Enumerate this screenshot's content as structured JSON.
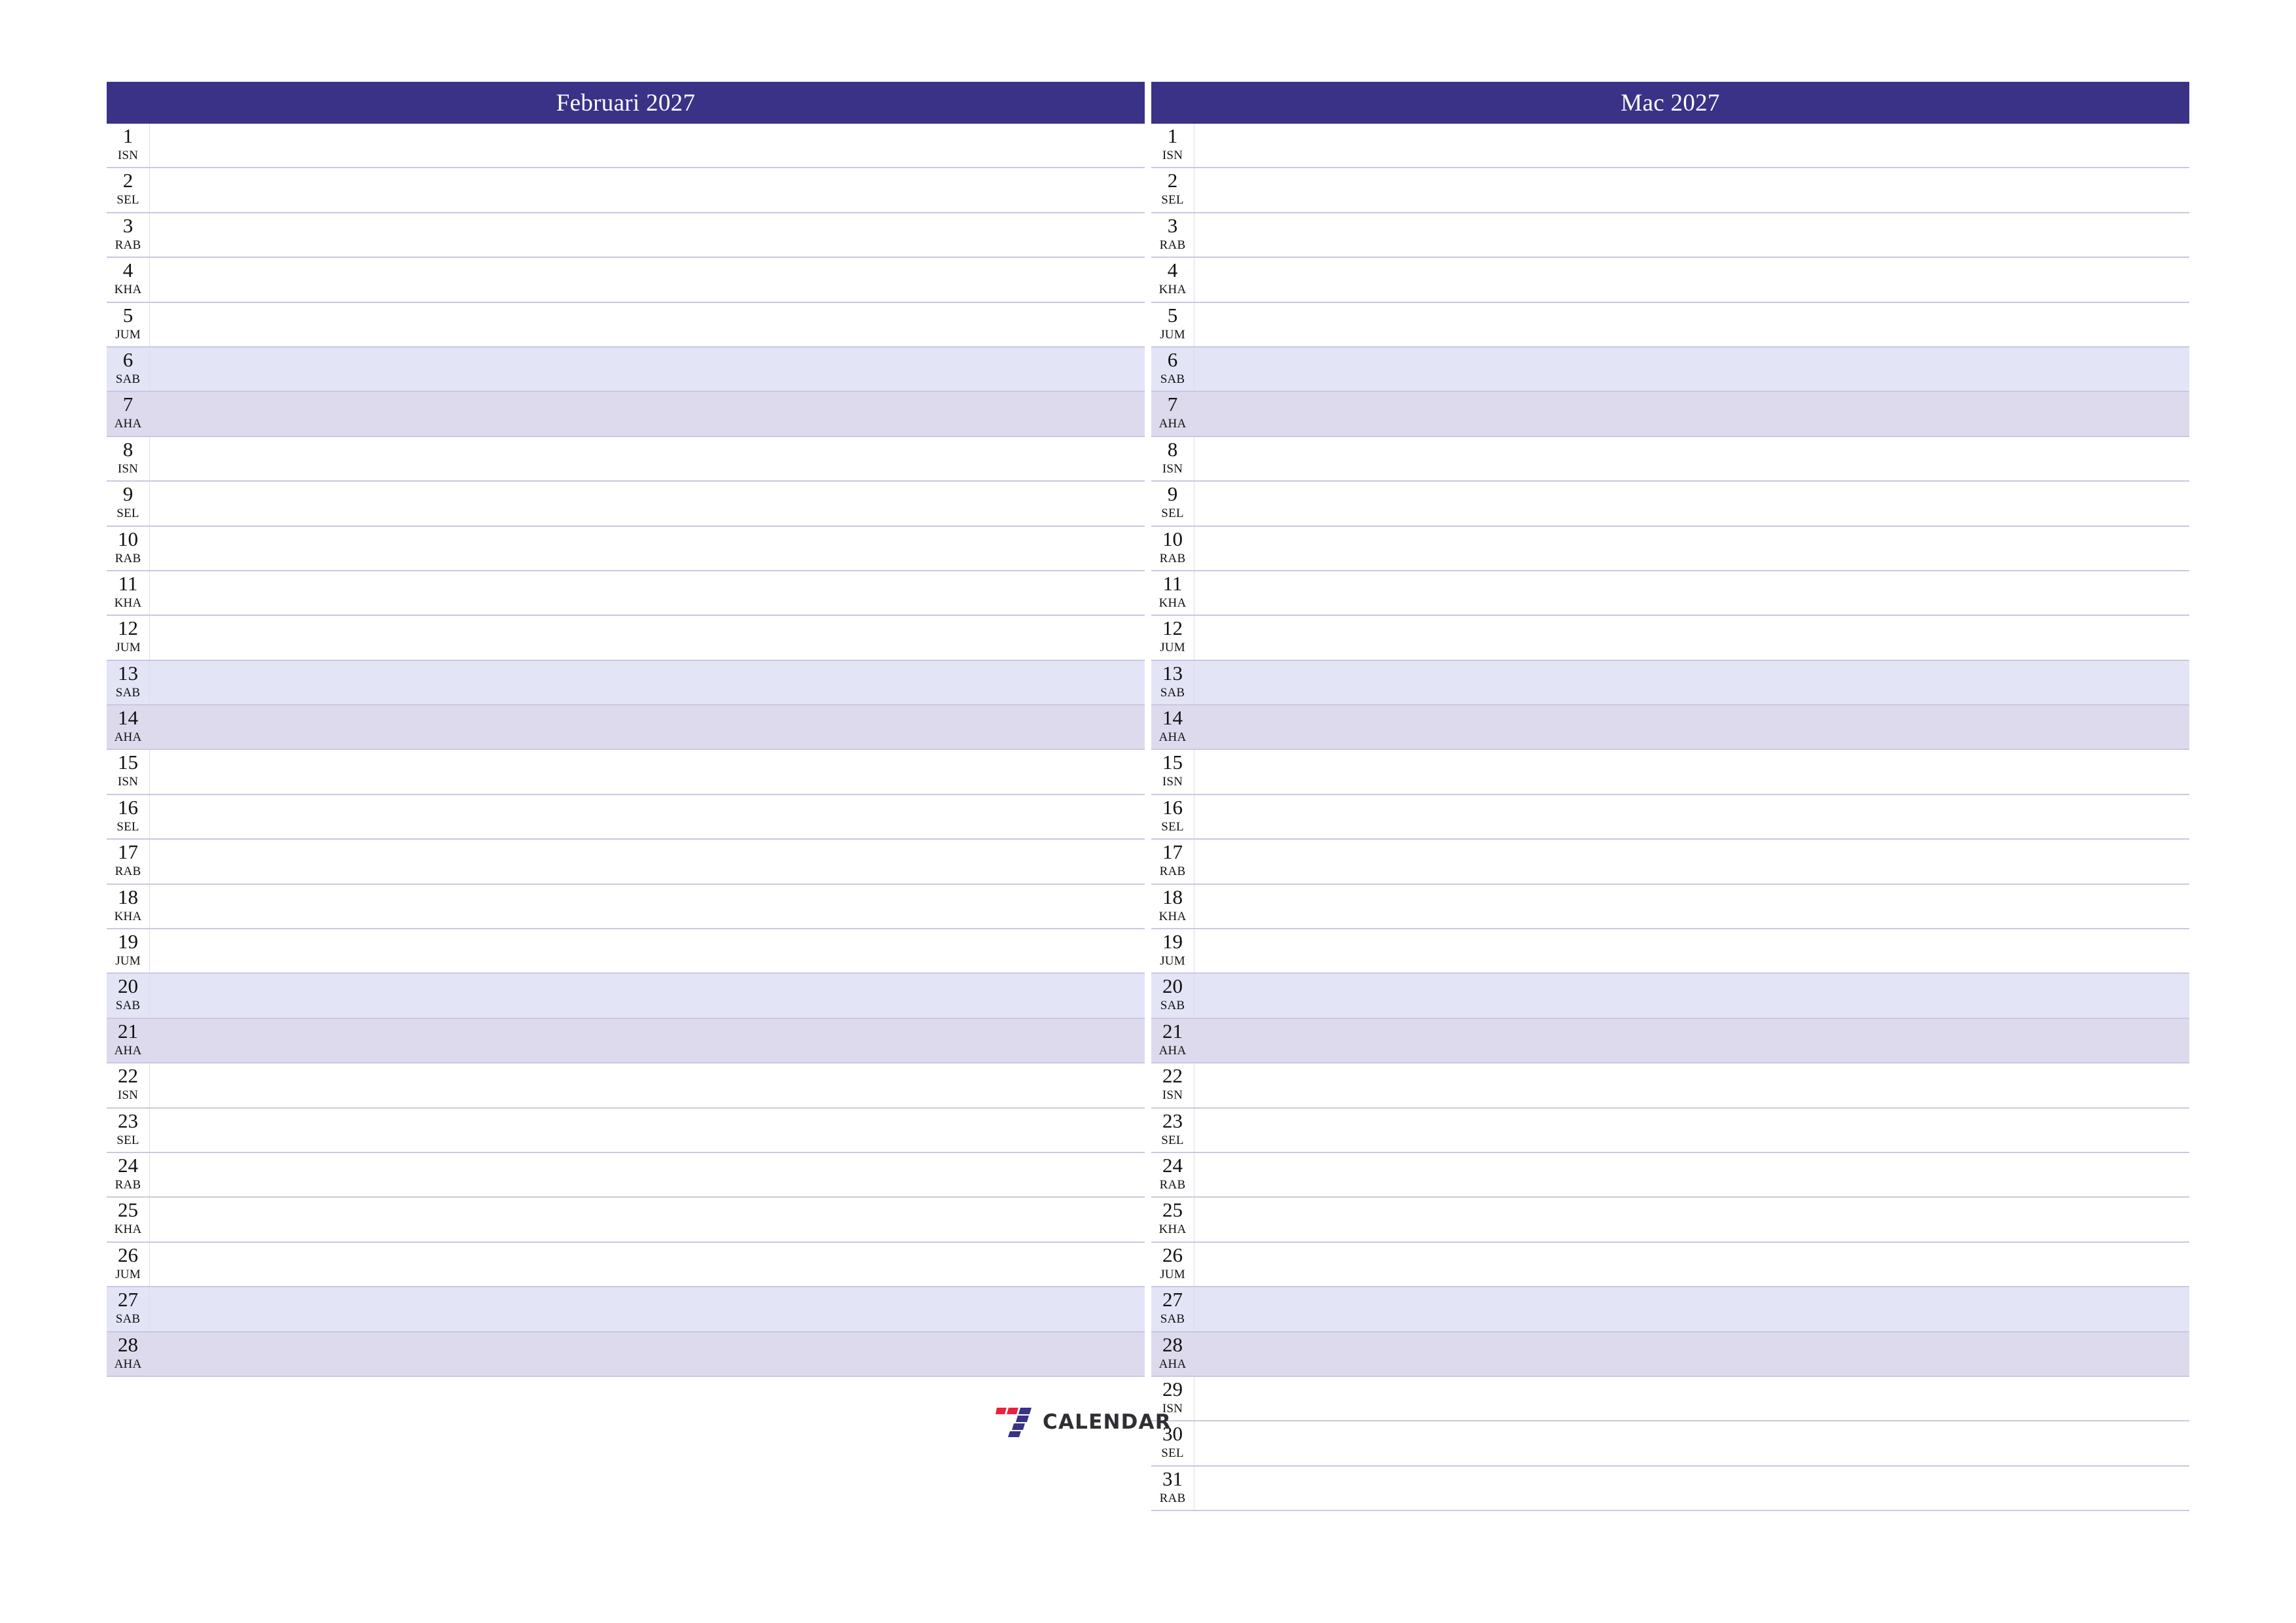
{
  "theme": {
    "header_bg": "#3a3287",
    "header_text": "#ffffff",
    "row_line": "#c9c8e4",
    "saturday_bg": "#e4e4f7",
    "sunday_bg": "#dcdaec",
    "day_text": "#111111",
    "logo_red": "#e8233f",
    "logo_purple": "#3a3287",
    "logo_word_color": "#2e2e33"
  },
  "brand": {
    "mark_name": "seven-logo-mark",
    "word": "CALENDAR"
  },
  "months": [
    {
      "title": "Februari 2027",
      "days": [
        {
          "num": "1",
          "abbr": "ISN",
          "type": "weekday"
        },
        {
          "num": "2",
          "abbr": "SEL",
          "type": "weekday"
        },
        {
          "num": "3",
          "abbr": "RAB",
          "type": "weekday"
        },
        {
          "num": "4",
          "abbr": "KHA",
          "type": "weekday"
        },
        {
          "num": "5",
          "abbr": "JUM",
          "type": "weekday"
        },
        {
          "num": "6",
          "abbr": "SAB",
          "type": "sat"
        },
        {
          "num": "7",
          "abbr": "AHA",
          "type": "sun"
        },
        {
          "num": "8",
          "abbr": "ISN",
          "type": "weekday"
        },
        {
          "num": "9",
          "abbr": "SEL",
          "type": "weekday"
        },
        {
          "num": "10",
          "abbr": "RAB",
          "type": "weekday"
        },
        {
          "num": "11",
          "abbr": "KHA",
          "type": "weekday"
        },
        {
          "num": "12",
          "abbr": "JUM",
          "type": "weekday"
        },
        {
          "num": "13",
          "abbr": "SAB",
          "type": "sat"
        },
        {
          "num": "14",
          "abbr": "AHA",
          "type": "sun"
        },
        {
          "num": "15",
          "abbr": "ISN",
          "type": "weekday"
        },
        {
          "num": "16",
          "abbr": "SEL",
          "type": "weekday"
        },
        {
          "num": "17",
          "abbr": "RAB",
          "type": "weekday"
        },
        {
          "num": "18",
          "abbr": "KHA",
          "type": "weekday"
        },
        {
          "num": "19",
          "abbr": "JUM",
          "type": "weekday"
        },
        {
          "num": "20",
          "abbr": "SAB",
          "type": "sat"
        },
        {
          "num": "21",
          "abbr": "AHA",
          "type": "sun"
        },
        {
          "num": "22",
          "abbr": "ISN",
          "type": "weekday"
        },
        {
          "num": "23",
          "abbr": "SEL",
          "type": "weekday"
        },
        {
          "num": "24",
          "abbr": "RAB",
          "type": "weekday"
        },
        {
          "num": "25",
          "abbr": "KHA",
          "type": "weekday"
        },
        {
          "num": "26",
          "abbr": "JUM",
          "type": "weekday"
        },
        {
          "num": "27",
          "abbr": "SAB",
          "type": "sat"
        },
        {
          "num": "28",
          "abbr": "AHA",
          "type": "sun"
        }
      ]
    },
    {
      "title": "Mac 2027",
      "days": [
        {
          "num": "1",
          "abbr": "ISN",
          "type": "weekday"
        },
        {
          "num": "2",
          "abbr": "SEL",
          "type": "weekday"
        },
        {
          "num": "3",
          "abbr": "RAB",
          "type": "weekday"
        },
        {
          "num": "4",
          "abbr": "KHA",
          "type": "weekday"
        },
        {
          "num": "5",
          "abbr": "JUM",
          "type": "weekday"
        },
        {
          "num": "6",
          "abbr": "SAB",
          "type": "sat"
        },
        {
          "num": "7",
          "abbr": "AHA",
          "type": "sun"
        },
        {
          "num": "8",
          "abbr": "ISN",
          "type": "weekday"
        },
        {
          "num": "9",
          "abbr": "SEL",
          "type": "weekday"
        },
        {
          "num": "10",
          "abbr": "RAB",
          "type": "weekday"
        },
        {
          "num": "11",
          "abbr": "KHA",
          "type": "weekday"
        },
        {
          "num": "12",
          "abbr": "JUM",
          "type": "weekday"
        },
        {
          "num": "13",
          "abbr": "SAB",
          "type": "sat"
        },
        {
          "num": "14",
          "abbr": "AHA",
          "type": "sun"
        },
        {
          "num": "15",
          "abbr": "ISN",
          "type": "weekday"
        },
        {
          "num": "16",
          "abbr": "SEL",
          "type": "weekday"
        },
        {
          "num": "17",
          "abbr": "RAB",
          "type": "weekday"
        },
        {
          "num": "18",
          "abbr": "KHA",
          "type": "weekday"
        },
        {
          "num": "19",
          "abbr": "JUM",
          "type": "weekday"
        },
        {
          "num": "20",
          "abbr": "SAB",
          "type": "sat"
        },
        {
          "num": "21",
          "abbr": "AHA",
          "type": "sun"
        },
        {
          "num": "22",
          "abbr": "ISN",
          "type": "weekday"
        },
        {
          "num": "23",
          "abbr": "SEL",
          "type": "weekday"
        },
        {
          "num": "24",
          "abbr": "RAB",
          "type": "weekday"
        },
        {
          "num": "25",
          "abbr": "KHA",
          "type": "weekday"
        },
        {
          "num": "26",
          "abbr": "JUM",
          "type": "weekday"
        },
        {
          "num": "27",
          "abbr": "SAB",
          "type": "sat"
        },
        {
          "num": "28",
          "abbr": "AHA",
          "type": "sun"
        },
        {
          "num": "29",
          "abbr": "ISN",
          "type": "weekday"
        },
        {
          "num": "30",
          "abbr": "SEL",
          "type": "weekday"
        },
        {
          "num": "31",
          "abbr": "RAB",
          "type": "weekday"
        }
      ]
    }
  ]
}
